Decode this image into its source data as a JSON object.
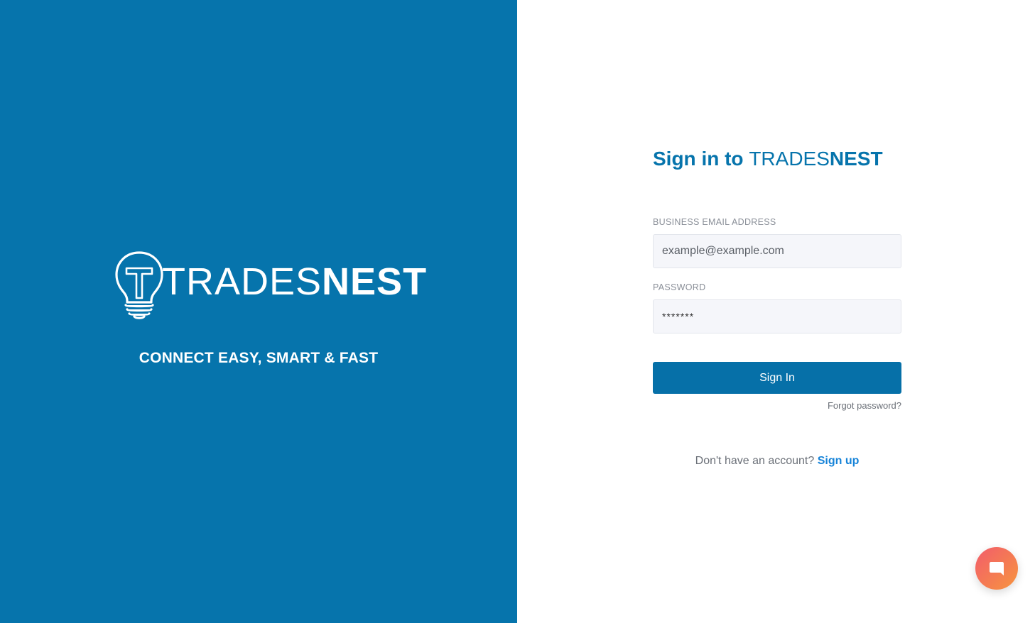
{
  "brand": {
    "logo_light": "TRADES",
    "logo_bold": "NEST",
    "tagline": "CONNECT EASY, SMART & FAST",
    "panel_color": "#0674ac",
    "logo_icon": "lightbulb-t-icon"
  },
  "form": {
    "title_prefix": "Sign in to ",
    "title_brand_light": "TRADES",
    "title_brand_bold": "NEST",
    "email": {
      "label": "BUSINESS EMAIL ADDRESS",
      "placeholder": "example@example.com",
      "value": ""
    },
    "password": {
      "label": "PASSWORD",
      "value": "*******"
    },
    "submit_label": "Sign In",
    "forgot_label": "Forgot password?",
    "signup_prompt": "Don't have an account? ",
    "signup_label": "Sign up",
    "accent_color": "#0670a8"
  },
  "chat": {
    "icon": "chat-bubble-icon",
    "gradient": [
      "#f25c6c",
      "#f7953e"
    ]
  }
}
